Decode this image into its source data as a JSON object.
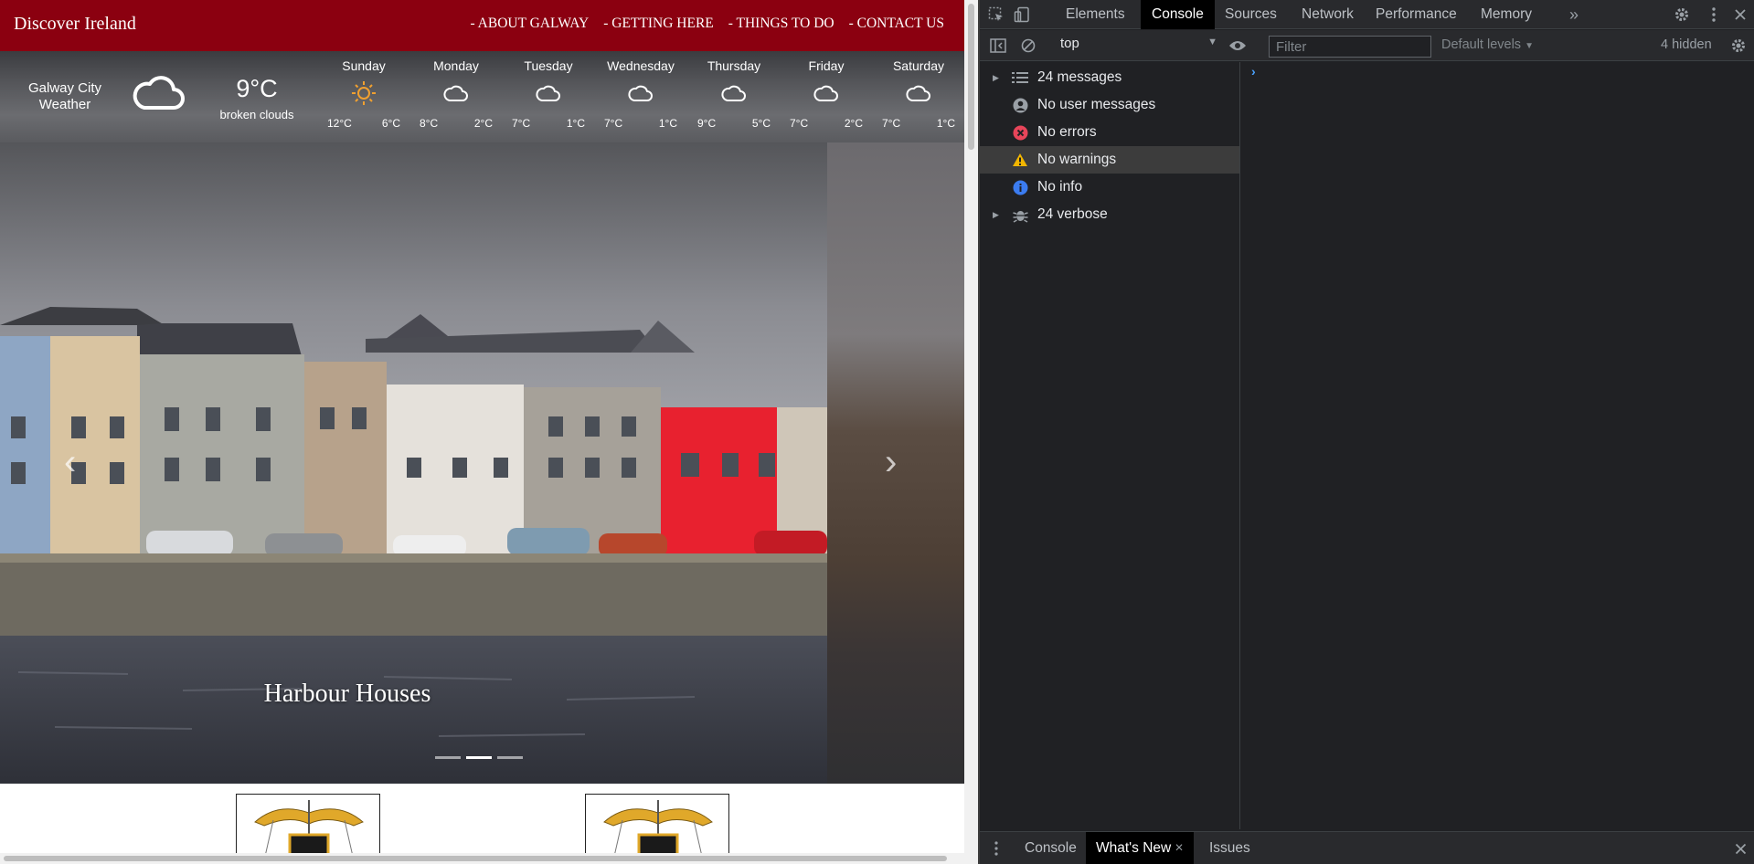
{
  "site": {
    "brand": "Discover Ireland",
    "nav": [
      "- ABOUT GALWAY",
      "- GETTING HERE",
      "- THINGS TO DO",
      "- CONTACT US"
    ],
    "weather": {
      "city": "Galway City Weather",
      "current_temp": "9°C",
      "description": "broken clouds",
      "days": [
        {
          "name": "Sunday",
          "icon": "sun-icon",
          "high": "12°C",
          "low": "6°C"
        },
        {
          "name": "Monday",
          "icon": "cloud-icon",
          "high": "8°C",
          "low": "2°C"
        },
        {
          "name": "Tuesday",
          "icon": "cloud-icon",
          "high": "7°C",
          "low": "1°C"
        },
        {
          "name": "Wednesday",
          "icon": "cloud-icon",
          "high": "7°C",
          "low": "1°C"
        },
        {
          "name": "Thursday",
          "icon": "cloud-icon",
          "high": "9°C",
          "low": "5°C"
        },
        {
          "name": "Friday",
          "icon": "cloud-icon",
          "high": "7°C",
          "low": "2°C"
        },
        {
          "name": "Saturday",
          "icon": "cloud-icon",
          "high": "7°C",
          "low": "1°C"
        }
      ]
    },
    "carousel": {
      "caption": "Harbour Houses",
      "prev_glyph": "‹",
      "next_glyph": "›",
      "slide_count": 3,
      "active_index": 1
    },
    "colors": {
      "brand": "#8b0010",
      "sun": "#f0a030"
    }
  },
  "devtools": {
    "tabs": [
      "Elements",
      "Console",
      "Sources",
      "Network",
      "Performance",
      "Memory"
    ],
    "active_tab": "Console",
    "more_tabs_glyph": "»",
    "context": "top",
    "filter_placeholder": "Filter",
    "levels_label": "Default levels",
    "hidden_label": "4 hidden",
    "sidebar": [
      {
        "label": "24 messages",
        "icon": "list-icon",
        "expandable": true
      },
      {
        "label": "No user messages",
        "icon": "user-icon",
        "expandable": false
      },
      {
        "label": "No errors",
        "icon": "error-icon",
        "expandable": false
      },
      {
        "label": "No warnings",
        "icon": "warning-icon",
        "expandable": false,
        "selected": true
      },
      {
        "label": "No info",
        "icon": "info-icon",
        "expandable": false
      },
      {
        "label": "24 verbose",
        "icon": "bug-icon",
        "expandable": true
      }
    ],
    "prompt_glyph": "›",
    "drawer_tabs": [
      "Console",
      "What's New",
      "Issues"
    ],
    "drawer_active": "What's New"
  }
}
